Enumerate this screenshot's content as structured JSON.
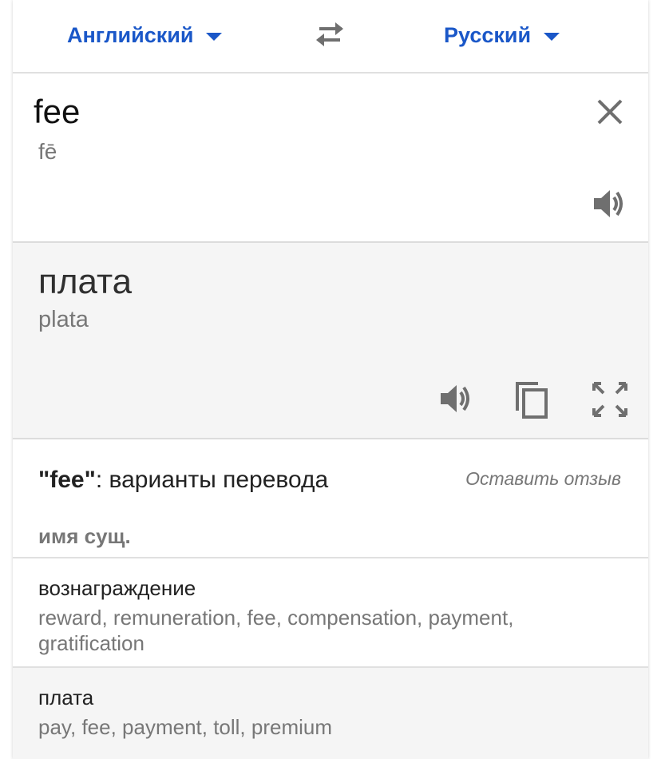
{
  "language_bar": {
    "source_language": "Английский",
    "target_language": "Русский",
    "swap_icon": "swap-arrows-icon"
  },
  "source": {
    "text": "fee",
    "transliteration": "fē",
    "clear_icon": "close-icon",
    "listen_icon": "speaker-icon"
  },
  "result": {
    "text": "плата",
    "transliteration": "plata",
    "listen_icon": "speaker-icon",
    "copy_icon": "copy-icon",
    "fullscreen_icon": "fullscreen-icon",
    "background": "#f5f5f5"
  },
  "variants": {
    "title_query": "\"fee\"",
    "title_suffix": ": варианты перевода",
    "feedback_link": "Оставить отзыв",
    "part_of_speech": "имя сущ.",
    "items": [
      {
        "word": "вознаграждение",
        "synonyms": "reward, remuneration, fee, compensation, payment, gratification"
      },
      {
        "word": "плата",
        "synonyms": "pay, fee, payment, toll, premium"
      }
    ]
  },
  "colors": {
    "accent": "#1a57c8",
    "icon_gray": "#6f6f6f",
    "secondary_text": "#777777"
  }
}
